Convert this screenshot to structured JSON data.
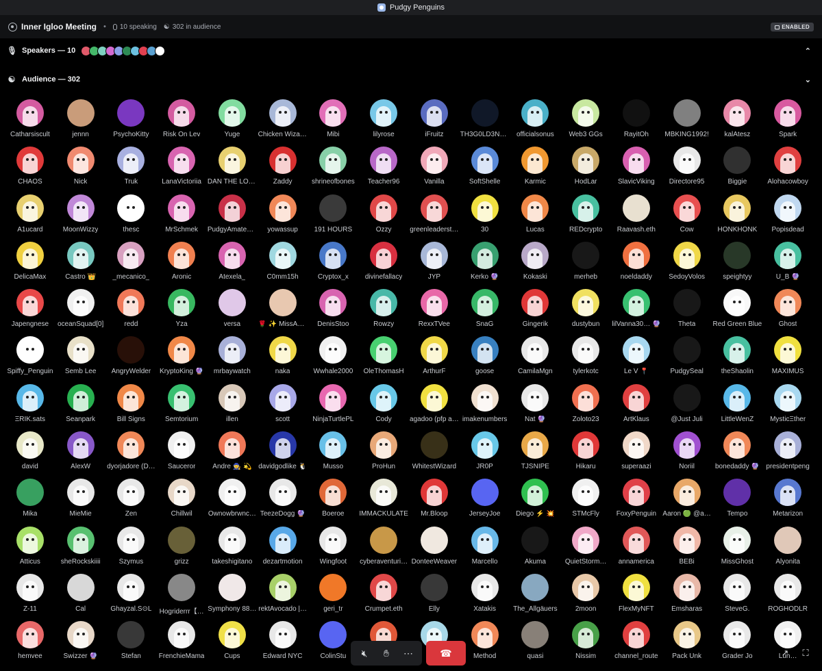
{
  "titlebar": {
    "server_name": "Pudgy Penguins"
  },
  "stage": {
    "name": "Inner Igloo Meeting",
    "separator": "•",
    "speaking": "10 speaking",
    "audience_count": "302 in audience",
    "badge": "ENABLED"
  },
  "speakers": {
    "label": "Speakers — 10",
    "avatar_colors": [
      "#e15a6a",
      "#45b86a",
      "#7ed0c0",
      "#d36ad0",
      "#8aa0e8",
      "#2d8a55",
      "#6cc0e0",
      "#e04050",
      "#5aa0d0",
      "#ffffff"
    ]
  },
  "audience": {
    "label": "Audience — 302",
    "members": [
      {
        "name": "Catharsiscult",
        "color": "#d45ba0"
      },
      {
        "name": "jennn",
        "color": "#c99c7a",
        "plain": true
      },
      {
        "name": "PsychoKitty",
        "color": "#7a38c0",
        "plain": true
      },
      {
        "name": "Risk On Lev",
        "color": "#d45ba0"
      },
      {
        "name": "Yuge",
        "color": "#82dca0"
      },
      {
        "name": "Chicken Wizar…",
        "color": "#a8b8d8"
      },
      {
        "name": "Mibi",
        "color": "#e26fb8"
      },
      {
        "name": "lilyrose",
        "color": "#78c8e8"
      },
      {
        "name": "iFruitz",
        "color": "#5a6cc0"
      },
      {
        "name": "TH3G0LD3N3…",
        "color": "#101828",
        "plain": true
      },
      {
        "name": "officialsonus",
        "color": "#4ab0c8"
      },
      {
        "name": "Web3 GGs",
        "color": "#c8e8a0"
      },
      {
        "name": "RayitOh",
        "color": "#111",
        "plain": true
      },
      {
        "name": "MBKING1992!",
        "color": "#808080",
        "plain": true
      },
      {
        "name": "kalAtesz",
        "color": "#e888a8"
      },
      {
        "name": "Spark",
        "color": "#d85aa0"
      },
      {
        "name": "CHAOS",
        "color": "#e03a3a"
      },
      {
        "name": "Nick",
        "color": "#f08a70"
      },
      {
        "name": "Truk",
        "color": "#a8b0e0"
      },
      {
        "name": "LanaVictoriia",
        "color": "#d864b0"
      },
      {
        "name": "DAN THE LOS…",
        "color": "#e8d070"
      },
      {
        "name": "Zaddy",
        "color": "#d83030"
      },
      {
        "name": "shrineofbones",
        "color": "#88d0a8"
      },
      {
        "name": "Teacher96",
        "color": "#b868c8"
      },
      {
        "name": "Vanilla",
        "color": "#f0a8b8"
      },
      {
        "name": "SoftShelle",
        "color": "#5a8ad8"
      },
      {
        "name": "Karmic",
        "color": "#f09830"
      },
      {
        "name": "HodLar",
        "color": "#c8a868"
      },
      {
        "name": "SlavicViking",
        "color": "#d860b0"
      },
      {
        "name": "Directore95",
        "color": "#e8e8e8"
      },
      {
        "name": "Biggie",
        "color": "#303030",
        "plain": true
      },
      {
        "name": "Alohacowboy",
        "color": "#e04040"
      },
      {
        "name": "A1ucard",
        "color": "#e8d070"
      },
      {
        "name": "MoonWizzy",
        "color": "#c088d8"
      },
      {
        "name": "thesc",
        "color": "#ffffff"
      },
      {
        "name": "MrSchmek",
        "color": "#d864b0"
      },
      {
        "name": "PudgyAmateu…",
        "color": "#c83048"
      },
      {
        "name": "yowassup",
        "color": "#f08858"
      },
      {
        "name": "191 HOURS",
        "color": "#3a3a3a",
        "plain": true
      },
      {
        "name": "Ozzy",
        "color": "#e04848"
      },
      {
        "name": "greenleaderst…",
        "color": "#e05050"
      },
      {
        "name": "30",
        "color": "#f0e040"
      },
      {
        "name": "Lucas",
        "color": "#f08848"
      },
      {
        "name": "REDcrypto",
        "color": "#48c0a0"
      },
      {
        "name": "Raavash.eth",
        "color": "#e8e0d0",
        "plain": true
      },
      {
        "name": "Cow",
        "color": "#e85050"
      },
      {
        "name": "HONKHONK",
        "color": "#e8c860"
      },
      {
        "name": "Popisdead",
        "color": "#c0d8f0"
      },
      {
        "name": "DelicaMax",
        "color": "#f0d040"
      },
      {
        "name": "Castro 👑",
        "color": "#78c8c0"
      },
      {
        "name": "_mecanico_",
        "color": "#d8a0c0"
      },
      {
        "name": "Aronic",
        "color": "#f08050"
      },
      {
        "name": "Atexela_",
        "color": "#d864b0"
      },
      {
        "name": "C0mm15h",
        "color": "#a0d8e0"
      },
      {
        "name": "Cryptox_x",
        "color": "#4878c8"
      },
      {
        "name": "divinefallacy",
        "color": "#d83040"
      },
      {
        "name": "JYP",
        "color": "#a8b8d8"
      },
      {
        "name": "Kerko 🔮",
        "color": "#38a070"
      },
      {
        "name": "Kokaski",
        "color": "#b8a8c8"
      },
      {
        "name": "merheb",
        "color": "#181818",
        "plain": true
      },
      {
        "name": "noeldaddy",
        "color": "#f07040"
      },
      {
        "name": "SedoyVolos",
        "color": "#f0d848"
      },
      {
        "name": "speightyy",
        "color": "#283828",
        "plain": true
      },
      {
        "name": "U_B 🔮",
        "color": "#48c0a0"
      },
      {
        "name": "Japengnese",
        "color": "#e84848"
      },
      {
        "name": "oceanSquad[0]",
        "color": "#f0f0f0"
      },
      {
        "name": "redd",
        "color": "#f07858"
      },
      {
        "name": "Yza",
        "color": "#38b860"
      },
      {
        "name": "versa",
        "color": "#e0c8e8",
        "plain": true
      },
      {
        "name": "🌹 ✨ MissAs…",
        "color": "#e8c8b0",
        "plain": true
      },
      {
        "name": "DenisStoo",
        "color": "#d864b0"
      },
      {
        "name": "Rowzy",
        "color": "#48b8a8"
      },
      {
        "name": "RexxTVee",
        "color": "#e868a8"
      },
      {
        "name": "SnaG",
        "color": "#38b868"
      },
      {
        "name": "Gingerik",
        "color": "#e03838"
      },
      {
        "name": "dustybun",
        "color": "#f0e060"
      },
      {
        "name": "lilVanna30… 🔮",
        "color": "#38c070"
      },
      {
        "name": "Theta",
        "color": "#181818",
        "plain": true
      },
      {
        "name": "Red Green Blue",
        "color": "#f8f8f8"
      },
      {
        "name": "Ghost",
        "color": "#f08858"
      },
      {
        "name": "Spiffy_Penguin",
        "color": "#ffffff"
      },
      {
        "name": "Semb Lee",
        "color": "#e8e0c8"
      },
      {
        "name": "AngryWelder",
        "color": "#281008",
        "plain": true
      },
      {
        "name": "KryptoKing 🔮",
        "color": "#f08848"
      },
      {
        "name": "mrbaywatch",
        "color": "#a8b0d8"
      },
      {
        "name": "naka",
        "color": "#f0d848"
      },
      {
        "name": "Wwhale2000",
        "color": "#f0f0f0"
      },
      {
        "name": "OleThomasH",
        "color": "#48d070"
      },
      {
        "name": "ArthurF",
        "color": "#f0d848"
      },
      {
        "name": "goose",
        "color": "#3880c0"
      },
      {
        "name": "CamilaMgn",
        "color": "#e8e8e8"
      },
      {
        "name": "tylerkotc",
        "color": "#e8e8e8"
      },
      {
        "name": "Le V 📍",
        "color": "#a8d8f0"
      },
      {
        "name": "PudgySeal",
        "color": "#181818",
        "plain": true
      },
      {
        "name": "theShaolin",
        "color": "#48c0a0"
      },
      {
        "name": "MAXIMUS",
        "color": "#f0e040"
      },
      {
        "name": "ΞRIK.sats",
        "color": "#58b8e8"
      },
      {
        "name": "Seanpark",
        "color": "#28b050"
      },
      {
        "name": "Bill Signs",
        "color": "#f08848"
      },
      {
        "name": "Semtorium",
        "color": "#38c070"
      },
      {
        "name": "illen",
        "color": "#d8c8b8"
      },
      {
        "name": "scott",
        "color": "#a8a8e8"
      },
      {
        "name": "NinjaTurtlePL",
        "color": "#e868b0"
      },
      {
        "name": "Cody",
        "color": "#68c8e8"
      },
      {
        "name": "agadoo (pfp a…",
        "color": "#f0e040"
      },
      {
        "name": "imakenumbers",
        "color": "#f0e0d0"
      },
      {
        "name": "Nat 🔮",
        "color": "#e8e8e8"
      },
      {
        "name": "Zoloto23",
        "color": "#f07050"
      },
      {
        "name": "ArtKlaus",
        "color": "#e04040"
      },
      {
        "name": "@Just Juli",
        "color": "#181818",
        "plain": true
      },
      {
        "name": "LittleWenZ",
        "color": "#58b8e8"
      },
      {
        "name": "MysticΞther",
        "color": "#a8d8f0"
      },
      {
        "name": "david",
        "color": "#e8e8c8"
      },
      {
        "name": "AlexW",
        "color": "#8858c8"
      },
      {
        "name": "dyorjadore (D…",
        "color": "#f08858"
      },
      {
        "name": "Sauceror",
        "color": "#f0f0f0"
      },
      {
        "name": "Andre 🧙 💫",
        "color": "#f07858"
      },
      {
        "name": "davidgodlike 🐧",
        "color": "#2838a8"
      },
      {
        "name": "Musso",
        "color": "#68c0e8"
      },
      {
        "name": "ProHun",
        "color": "#e8a878"
      },
      {
        "name": "WhitestWizard",
        "color": "#383018",
        "plain": true
      },
      {
        "name": "JR0P",
        "color": "#68c8e8"
      },
      {
        "name": "TJSNIPE",
        "color": "#e8a848"
      },
      {
        "name": "Hikaru",
        "color": "#e03838"
      },
      {
        "name": "superaazi",
        "color": "#f0d8c8"
      },
      {
        "name": "Noriil",
        "color": "#a050d0"
      },
      {
        "name": "bonedaddy 🔮",
        "color": "#f08858"
      },
      {
        "name": "presidentpeng",
        "color": "#a8b0d8"
      },
      {
        "name": "Mika",
        "color": "#38a060",
        "plain": true
      },
      {
        "name": "MieMie",
        "color": "#e8e8e8"
      },
      {
        "name": "Zen",
        "color": "#e8e8e8"
      },
      {
        "name": "Chillwil",
        "color": "#e8d8c8"
      },
      {
        "name": "Ownowbrwnc…",
        "color": "#f0f0f0"
      },
      {
        "name": "TeezeDogg 🔮",
        "color": "#e8e8e8"
      },
      {
        "name": "Boeroe",
        "color": "#e06838"
      },
      {
        "name": "IMMACKULATE",
        "color": "#e8e8d8"
      },
      {
        "name": "Mr.Bloop",
        "color": "#e03838"
      },
      {
        "name": "JerseyJoe",
        "color": "#5865f2",
        "plain": true
      },
      {
        "name": "Diego ⚡ 💥",
        "color": "#30c050"
      },
      {
        "name": "STMcFly",
        "color": "#f0f0f0"
      },
      {
        "name": "FoxyPenguin",
        "color": "#e04048"
      },
      {
        "name": "Aaron 🟢 @a…",
        "color": "#e8a868"
      },
      {
        "name": "Tempo",
        "color": "#6030a8",
        "plain": true
      },
      {
        "name": "Metarizon",
        "color": "#5878d0"
      },
      {
        "name": "Atticus",
        "color": "#a8e068"
      },
      {
        "name": "sheRockskiiii",
        "color": "#58c070"
      },
      {
        "name": "Szymus",
        "color": "#e8e8e8"
      },
      {
        "name": "grizz",
        "color": "#686038",
        "plain": true
      },
      {
        "name": "takeshigitano",
        "color": "#e8e8e8"
      },
      {
        "name": "dezartmotion",
        "color": "#58a8e8"
      },
      {
        "name": "Wingfoot",
        "color": "#e8e8e8"
      },
      {
        "name": "cyberaventuri…",
        "color": "#c89848",
        "plain": true
      },
      {
        "name": "DonteeWeaver",
        "color": "#f0e8e0",
        "plain": true
      },
      {
        "name": "Marcello",
        "color": "#68b8e8"
      },
      {
        "name": "Akuma",
        "color": "#181818",
        "plain": true
      },
      {
        "name": "QuietStorm…",
        "color": "#f0a8c8"
      },
      {
        "name": "annamerica",
        "color": "#e05858"
      },
      {
        "name": "BEBi",
        "color": "#f0b8a8"
      },
      {
        "name": "MissGhost",
        "color": "#e8f0e8"
      },
      {
        "name": "Alyonita",
        "color": "#e0c8b8",
        "plain": true
      },
      {
        "name": "Z-11",
        "color": "#e8e8e8"
      },
      {
        "name": "Cal",
        "color": "#d8d8d8",
        "plain": true
      },
      {
        "name": "Ghayzal.S⊙L",
        "color": "#e8e8e8"
      },
      {
        "name": "Hogriderrr【…",
        "color": "#888888",
        "plain": true
      },
      {
        "name": "Symphony 88…",
        "color": "#f0e8e8",
        "plain": true
      },
      {
        "name": "rektAvocado |…",
        "color": "#a8d068"
      },
      {
        "name": "geri_tr",
        "color": "#f07828",
        "plain": true
      },
      {
        "name": "Crumpet.eth",
        "color": "#e04848"
      },
      {
        "name": "Elly",
        "color": "#383838",
        "plain": true
      },
      {
        "name": "Xatakis",
        "color": "#e8e8e8"
      },
      {
        "name": "The_Allgäuers",
        "color": "#88a8c0",
        "plain": true
      },
      {
        "name": "2moon",
        "color": "#e8c8a8"
      },
      {
        "name": "FlexMyNFT",
        "color": "#f0e040"
      },
      {
        "name": "Emsharas",
        "color": "#e8b8a8"
      },
      {
        "name": "SteveG.",
        "color": "#e8e8e8"
      },
      {
        "name": "ROGHODLR",
        "color": "#e8e8e8"
      },
      {
        "name": "hemvee",
        "color": "#e86868"
      },
      {
        "name": "Swizzer 🔮",
        "color": "#e8d8c8"
      },
      {
        "name": "Stefan",
        "color": "#383838",
        "plain": true
      },
      {
        "name": "FrenchieMama",
        "color": "#e8e8e8"
      },
      {
        "name": "Cups",
        "color": "#f0e048"
      },
      {
        "name": "Edward NYC",
        "color": "#e8e8e8"
      },
      {
        "name": "ColinStu",
        "color": "#5865f2",
        "plain": true
      },
      {
        "name": "",
        "color": "#e05838"
      },
      {
        "name": "",
        "color": "#a8d8e8"
      },
      {
        "name": "Method",
        "color": "#f08858"
      },
      {
        "name": "quasi",
        "color": "#888078",
        "plain": true
      },
      {
        "name": "Nissim",
        "color": "#48a048"
      },
      {
        "name": "channel_route",
        "color": "#e04040"
      },
      {
        "name": "Pack Unk",
        "color": "#e8c888"
      },
      {
        "name": "Grader Jo",
        "color": "#e8e8e8"
      },
      {
        "name": "Lun…",
        "color": "#f0f0f0"
      }
    ]
  },
  "controls": {
    "mic_icon": "mic-muted-icon",
    "hand_icon": "raise-hand-icon",
    "more_icon": "more-icon",
    "leave_icon": "phone-hangup-icon",
    "leave_color": "#da373c"
  }
}
